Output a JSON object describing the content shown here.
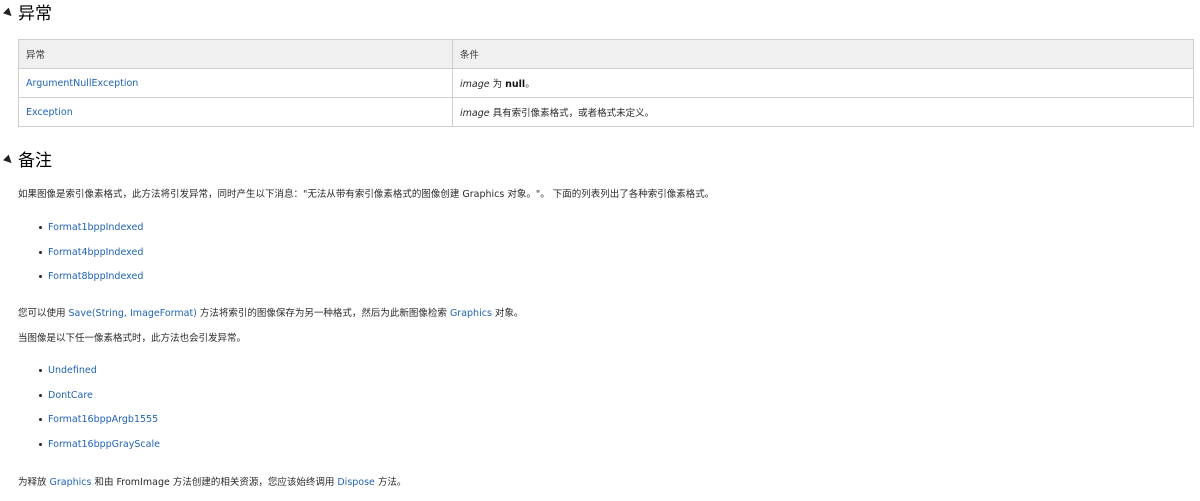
{
  "exceptions_section": {
    "title": "异常",
    "headers": {
      "exception": "异常",
      "condition": "条件"
    },
    "rows": [
      {
        "exception": "ArgumentNullException",
        "cond_param": "image",
        "cond_mid": " 为 ",
        "cond_bold": "null",
        "cond_end": "。"
      },
      {
        "exception": "Exception",
        "cond_param": "image",
        "cond_mid": " 具有索引像素格式，或者格式未定义。",
        "cond_bold": "",
        "cond_end": ""
      }
    ]
  },
  "remarks_section": {
    "title": "备注",
    "p1": "如果图像是索引像素格式，此方法将引发异常，同时产生以下消息：\"无法从带有索引像素格式的图像创建 Graphics 对象。\"。 下面的列表列出了各种索引像素格式。",
    "list1": [
      "Format1bppIndexed",
      "Format4bppIndexed",
      "Format8bppIndexed"
    ],
    "p2": {
      "pre": "您可以使用 ",
      "link1": "Save(String, ImageFormat)",
      "mid": " 方法将索引的图像保存为另一种格式，然后为此新图像检索 ",
      "link2": "Graphics",
      "post": " 对象。"
    },
    "p3": "当图像是以下任一像素格式时，此方法也会引发异常。",
    "list2": [
      "Undefined",
      "DontCare",
      "Format16bppArgb1555",
      "Format16bppGrayScale"
    ],
    "p4": {
      "pre": "为释放 ",
      "link1": "Graphics",
      "mid": " 和由 FromImage 方法创建的相关资源，您应该始终调用 ",
      "link2": "Dispose",
      "post": " 方法。"
    }
  }
}
